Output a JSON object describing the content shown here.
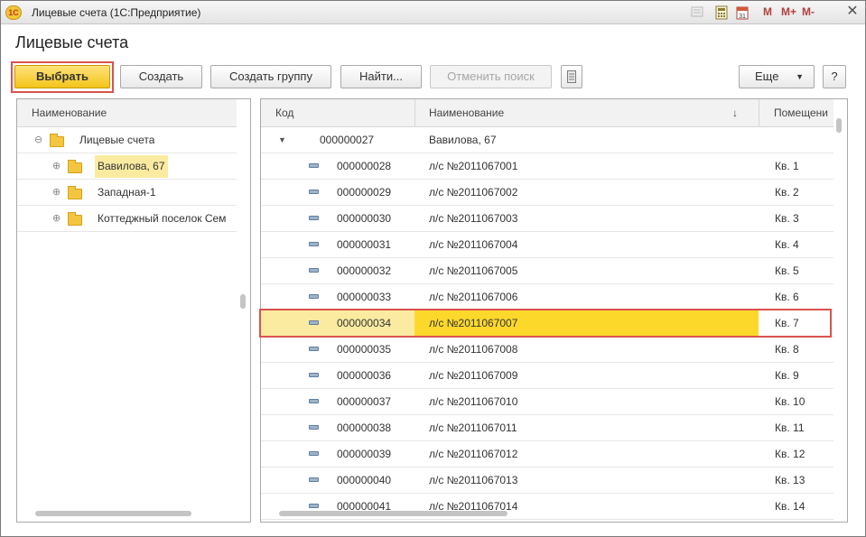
{
  "window": {
    "title": "Лицевые счета  (1С:Предприятие)",
    "logo_text": "1С",
    "toolbar_icons": [
      "calculator-icon",
      "calendar-icon",
      "history-icon"
    ],
    "memory_buttons": [
      "M",
      "M+",
      "M-"
    ],
    "close_glyph": "✕",
    "calendar_day": "31"
  },
  "form": {
    "title": "Лицевые счета"
  },
  "toolbar": {
    "select_label": "Выбрать",
    "create_label": "Создать",
    "create_group_label": "Создать группу",
    "find_label": "Найти...",
    "cancel_search_label": "Отменить поиск",
    "more_label": "Еще",
    "help_label": "?"
  },
  "left_tree": {
    "header": "Наименование",
    "items": [
      {
        "label": "Лицевые счета",
        "level": 0,
        "expanded": true
      },
      {
        "label": "Вавилова, 67",
        "level": 1,
        "expanded": false,
        "current": true
      },
      {
        "label": "Западная-1",
        "level": 1,
        "expanded": false
      },
      {
        "label": "Коттеджный поселок Сем",
        "level": 1,
        "expanded": false
      }
    ]
  },
  "right_table": {
    "headers": {
      "code": "Код",
      "name": "Наименование",
      "sort_glyph": "↓",
      "room": "Помещени"
    },
    "group_row": {
      "code": "000000027",
      "name": "Вавилова, 67",
      "room": ""
    },
    "rows": [
      {
        "code": "000000028",
        "name": "л/с №2011067001",
        "room": "Кв. 1"
      },
      {
        "code": "000000029",
        "name": "л/с №2011067002",
        "room": "Кв. 2"
      },
      {
        "code": "000000030",
        "name": "л/с №2011067003",
        "room": "Кв. 3"
      },
      {
        "code": "000000031",
        "name": "л/с №2011067004",
        "room": "Кв. 4"
      },
      {
        "code": "000000032",
        "name": "л/с №2011067005",
        "room": "Кв. 5"
      },
      {
        "code": "000000033",
        "name": "л/с №2011067006",
        "room": "Кв. 6"
      },
      {
        "code": "000000034",
        "name": "л/с №2011067007",
        "room": "Кв. 7",
        "selected": true
      },
      {
        "code": "000000035",
        "name": "л/с №2011067008",
        "room": "Кв. 8"
      },
      {
        "code": "000000036",
        "name": "л/с №2011067009",
        "room": "Кв. 9"
      },
      {
        "code": "000000037",
        "name": "л/с №2011067010",
        "room": "Кв. 10"
      },
      {
        "code": "000000038",
        "name": "л/с №2011067011",
        "room": "Кв. 11"
      },
      {
        "code": "000000039",
        "name": "л/с №2011067012",
        "room": "Кв. 12"
      },
      {
        "code": "000000040",
        "name": "л/с №2011067013",
        "room": "Кв. 13"
      },
      {
        "code": "000000041",
        "name": "л/с №2011067014",
        "room": "Кв. 14"
      }
    ]
  },
  "colors": {
    "accent_button": "#f3c51b",
    "selected_row": "#fbeba0",
    "selected_cell": "#fcd82b",
    "highlight_frame": "#d9534f"
  }
}
